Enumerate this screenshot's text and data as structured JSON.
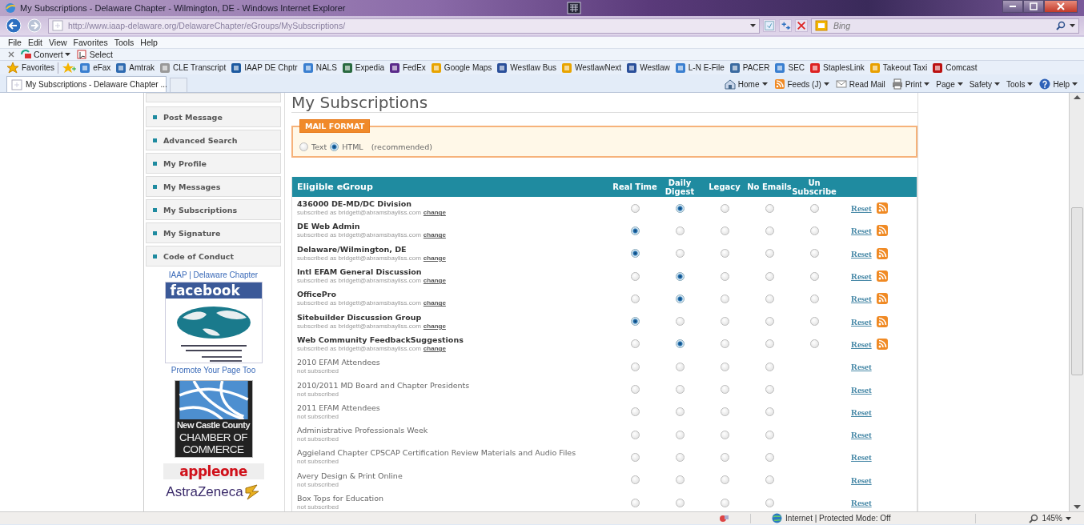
{
  "window": {
    "title": "My Subscriptions - Delaware Chapter - Wilmington, DE - Windows Internet Explorer"
  },
  "address_bar": {
    "url": "http://www.iaap-delaware.org/DelawareChapter/eGroups/MySubscriptions/",
    "search_placeholder": "Bing"
  },
  "menu_bar": [
    "File",
    "Edit",
    "View",
    "Favorites",
    "Tools",
    "Help"
  ],
  "toolbar": [
    {
      "label": "Convert",
      "has_menu": true
    },
    {
      "label": "Select",
      "has_menu": false
    }
  ],
  "favorites_bar": {
    "label": "Favorites",
    "links": [
      "eFax",
      "Amtrak",
      "CLE Transcript",
      "IAAP DE Chptr",
      "NALS",
      "Expedia",
      "FedEx",
      "Google Maps",
      "Westlaw Bus",
      "WestlawNext",
      "Westlaw",
      "L-N E-File",
      "PACER",
      "SEC",
      "StaplesLink",
      "Takeout Taxi",
      "Comcast"
    ]
  },
  "tabs": [
    {
      "label": "My Subscriptions - Delaware Chapter ...",
      "selected": true
    }
  ],
  "command_bar": [
    {
      "label": "Home",
      "has_menu": true
    },
    {
      "label": "Feeds (J)",
      "has_menu": true
    },
    {
      "label": "Read Mail",
      "has_menu": false
    },
    {
      "label": "Print",
      "has_menu": true
    },
    {
      "label": "Page",
      "has_menu": true
    },
    {
      "label": "Safety",
      "has_menu": true
    },
    {
      "label": "Tools",
      "has_menu": true
    },
    {
      "label": "Help",
      "has_menu": true
    }
  ],
  "sidebar": {
    "items": [
      {
        "label": "Post Message",
        "selected": false
      },
      {
        "label": "Advanced Search",
        "selected": false
      },
      {
        "label": "My Profile",
        "selected": false
      },
      {
        "label": "My Messages",
        "selected": false
      },
      {
        "label": "My Subscriptions",
        "selected": false
      },
      {
        "label": "My Signature",
        "selected": false
      },
      {
        "label": "Code of Conduct",
        "selected": false
      }
    ],
    "facebook_link": "IAAP | Delaware Chapter",
    "facebook_badge": "facebook",
    "promote_link": "Promote Your Page Too",
    "sponsors": [
      {
        "kind": "chamber",
        "lines": [
          "New Castle County",
          "CHAMBER OF",
          "COMMERCE"
        ]
      },
      {
        "kind": "appleone",
        "lines": [
          "appleone"
        ]
      },
      {
        "kind": "astrazeneca",
        "lines": [
          "AstraZeneca"
        ]
      }
    ]
  },
  "page": {
    "title": "My Subscriptions",
    "mail_format": {
      "legend": "MAIL FORMAT",
      "options": [
        {
          "label": "Text",
          "selected": false
        },
        {
          "label": "HTML",
          "selected": true
        }
      ],
      "note": "(recommended)"
    },
    "table": {
      "columns": [
        "Eligible eGroup",
        "Real Time",
        "Daily Digest",
        "Legacy",
        "No Emails",
        "Un Subscribe"
      ],
      "rows": [
        {
          "name": "436000 DE-MD/DC Division",
          "kind": "subscribed",
          "status": "subscribed as bridgett@abramsbayliss.com",
          "link": "change",
          "options": [
            {
              "selected": false
            },
            {
              "selected": true
            },
            {
              "selected": false
            },
            {
              "selected": false
            },
            {
              "selected": false
            }
          ],
          "reset": "Reset",
          "rss": true
        },
        {
          "name": "DE Web Admin",
          "kind": "subscribed",
          "status": "subscribed as bridgett@abramsbayliss.com",
          "link": "change",
          "options": [
            {
              "selected": true
            },
            {
              "selected": false
            },
            {
              "selected": false
            },
            {
              "selected": false
            },
            {
              "selected": false
            }
          ],
          "reset": "Reset",
          "rss": true
        },
        {
          "name": "Delaware/Wilmington, DE",
          "kind": "subscribed",
          "status": "subscribed as bridgett@abramsbayliss.com",
          "link": "change",
          "options": [
            {
              "selected": true
            },
            {
              "selected": false
            },
            {
              "selected": false
            },
            {
              "selected": false
            },
            {
              "selected": false
            }
          ],
          "reset": "Reset",
          "rss": true
        },
        {
          "name": "Intl EFAM General Discussion",
          "kind": "subscribed",
          "status": "subscribed as bridgett@abramsbayliss.com",
          "link": "change",
          "options": [
            {
              "selected": false
            },
            {
              "selected": true
            },
            {
              "selected": false
            },
            {
              "selected": false
            },
            {
              "selected": false
            }
          ],
          "reset": "Reset",
          "rss": true
        },
        {
          "name": "OfficePro",
          "kind": "subscribed",
          "status": "subscribed as bridgett@abramsbayliss.com",
          "link": "change",
          "options": [
            {
              "selected": false
            },
            {
              "selected": true
            },
            {
              "selected": false
            },
            {
              "selected": false
            },
            {
              "selected": false
            }
          ],
          "reset": "Reset",
          "rss": true
        },
        {
          "name": "Sitebuilder Discussion Group",
          "kind": "subscribed",
          "status": "subscribed as bridgett@abramsbayliss.com",
          "link": "change",
          "options": [
            {
              "selected": true
            },
            {
              "selected": false
            },
            {
              "selected": false
            },
            {
              "selected": false
            },
            {
              "selected": false
            }
          ],
          "reset": "Reset",
          "rss": true
        },
        {
          "name": "Web Community FeedbackSuggestions",
          "kind": "subscribed",
          "status": "subscribed as bridgett@abramsbayliss.com",
          "link": "change",
          "options": [
            {
              "selected": false
            },
            {
              "selected": true
            },
            {
              "selected": false
            },
            {
              "selected": false
            },
            {
              "selected": false
            }
          ],
          "reset": "Reset",
          "rss": true
        },
        {
          "name": "2010 EFAM Attendees",
          "kind": "not_subscribed",
          "status": "not subscribed",
          "options": [
            {
              "selected": false
            },
            {
              "selected": false
            },
            {
              "selected": false
            },
            {
              "selected": false
            }
          ],
          "reset": "Reset",
          "rss": false
        },
        {
          "name": "2010/2011 MD Board and Chapter Presidents",
          "kind": "not_subscribed",
          "status": "not subscribed",
          "options": [
            {
              "selected": false
            },
            {
              "selected": false
            },
            {
              "selected": false
            },
            {
              "selected": false
            }
          ],
          "reset": "Reset",
          "rss": false
        },
        {
          "name": "2011 EFAM Attendees",
          "kind": "not_subscribed",
          "status": "not subscribed",
          "options": [
            {
              "selected": false
            },
            {
              "selected": false
            },
            {
              "selected": false
            },
            {
              "selected": false
            }
          ],
          "reset": "Reset",
          "rss": false
        },
        {
          "name": "Administrative Professionals Week",
          "kind": "not_subscribed",
          "status": "not subscribed",
          "options": [
            {
              "selected": false
            },
            {
              "selected": false
            },
            {
              "selected": false
            },
            {
              "selected": false
            }
          ],
          "reset": "Reset",
          "rss": false
        },
        {
          "name": "Aggieland Chapter CPSCAP Certification Review Materials and Audio Files",
          "kind": "not_subscribed",
          "status": "not subscribed",
          "options": [
            {
              "selected": false
            },
            {
              "selected": false
            },
            {
              "selected": false
            },
            {
              "selected": false
            }
          ],
          "reset": "Reset",
          "rss": false
        },
        {
          "name": "Avery Design & Print Online",
          "kind": "not_subscribed",
          "status": "not subscribed",
          "options": [
            {
              "selected": false
            },
            {
              "selected": false
            },
            {
              "selected": false
            },
            {
              "selected": false
            }
          ],
          "reset": "Reset",
          "rss": false
        },
        {
          "name": "Box Tops for Education",
          "kind": "not_subscribed",
          "status": "not subscribed",
          "options": [
            {
              "selected": false
            },
            {
              "selected": false
            },
            {
              "selected": false
            },
            {
              "selected": false
            }
          ],
          "reset": "Reset",
          "rss": false
        }
      ]
    }
  },
  "status_bar": {
    "zone": "Internet | Protected Mode: Off",
    "zoom": "145%"
  }
}
